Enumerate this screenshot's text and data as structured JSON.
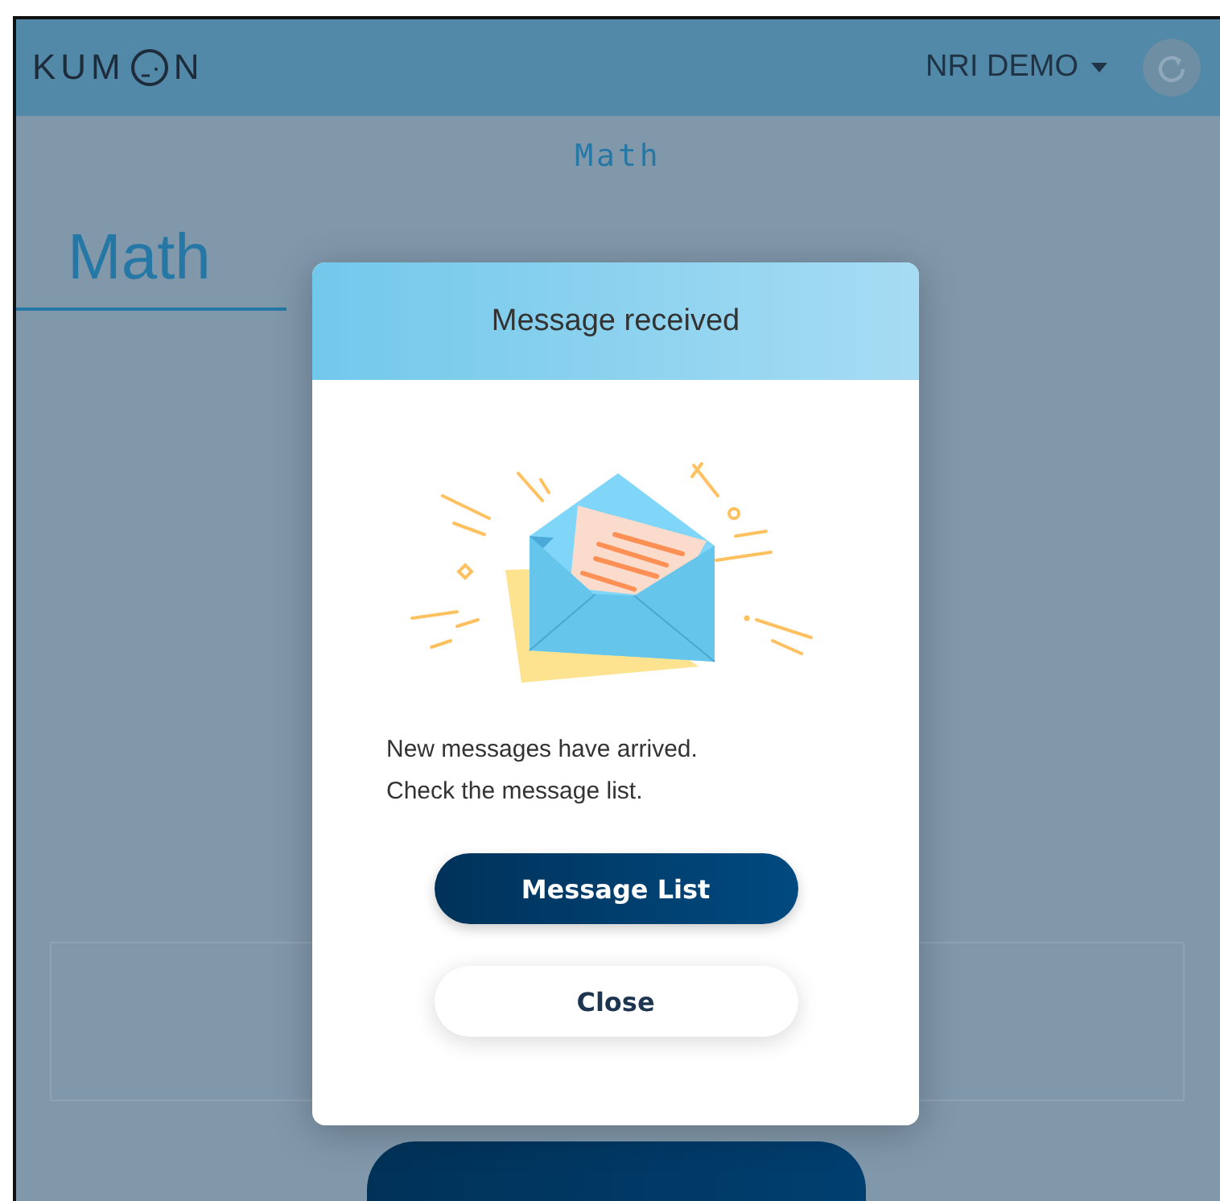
{
  "header": {
    "logo_parts": [
      "KUM",
      "N"
    ],
    "user": "NRI DEMO"
  },
  "page": {
    "subtitle": "Math",
    "tab": "Math"
  },
  "dialog": {
    "title": "Message received",
    "message_lines": [
      "New messages have arrived.",
      "Check the message list."
    ],
    "buttons": [
      {
        "label": "Message List",
        "kind": "primary"
      },
      {
        "label": "Close",
        "kind": "secondary"
      }
    ]
  }
}
